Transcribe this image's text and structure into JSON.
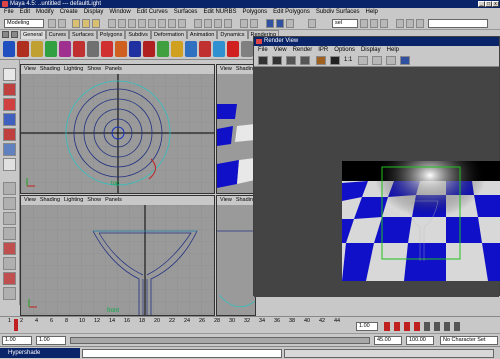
{
  "window": {
    "title": "Maya 4.5: ..untitled  ---  defaultLight"
  },
  "menubar": [
    "File",
    "Edit",
    "Modify",
    "Create",
    "Display",
    "Window",
    "Edit Curves",
    "Surfaces",
    "Edit NURBS",
    "Polygons",
    "Edit Polygons",
    "Subdiv Surfaces",
    "Help"
  ],
  "statusline": {
    "mode": "Modeling",
    "selection_field": "sel"
  },
  "shelf": {
    "tabs": [
      "General",
      "Curves",
      "Surfaces",
      "Polygons",
      "Subdivs",
      "Deformation",
      "Animation",
      "Dynamics",
      "Rendering"
    ],
    "active_tab": "General"
  },
  "viewports": {
    "menu": [
      "View",
      "Shading",
      "Lighting",
      "Show",
      "Panels"
    ],
    "top_label": "top",
    "front_label": "front",
    "side_label": "side"
  },
  "render_view": {
    "title": "Render View",
    "menu": [
      "File",
      "View",
      "Render",
      "IPR",
      "Options",
      "Display",
      "Help"
    ],
    "ratio_label": "1:1"
  },
  "timeslider": {
    "ticks": [
      "1",
      "2",
      "4",
      "6",
      "8",
      "10",
      "12",
      "14",
      "16",
      "18",
      "20",
      "22",
      "24",
      "26",
      "28",
      "30",
      "32",
      "34",
      "36",
      "38",
      "40",
      "42",
      "44"
    ],
    "current_frame": "1.00"
  },
  "range": {
    "start": "1.00",
    "anim_start": "1.00",
    "range_end": "45.00",
    "anim_end": "100.00",
    "character_set": "No Character Set"
  },
  "command": {
    "hypershade_label": "Hypershade"
  },
  "colors": {
    "accent": "#0a246a",
    "checker_blue": "#1010c8",
    "grid_bg": "#9a9a9a"
  }
}
